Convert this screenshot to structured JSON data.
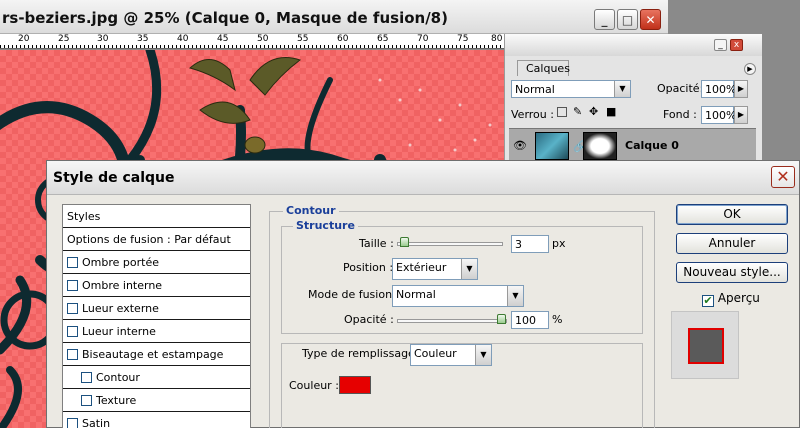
{
  "document": {
    "title": "rs-beziers.jpg @ 25% (Calque 0, Masque de fusion/8)",
    "ruler_marks": [
      "20",
      "25",
      "30",
      "35",
      "40",
      "45",
      "50",
      "55",
      "60",
      "65",
      "70",
      "75",
      "80"
    ]
  },
  "layers_panel": {
    "tab": "Calques",
    "blend_mode": "Normal",
    "opacity_label": "Opacité:",
    "opacity_value": "100%",
    "lock_label": "Verrou :",
    "fill_label": "Fond :",
    "fill_value": "100%",
    "layer_name": "Calque 0"
  },
  "dialog": {
    "title": "Style de calque",
    "styles": [
      {
        "label": "Styles",
        "type": "header"
      },
      {
        "label": "Options de fusion : Par défaut",
        "type": "header"
      },
      {
        "label": "Ombre portée",
        "type": "check"
      },
      {
        "label": "Ombre interne",
        "type": "check"
      },
      {
        "label": "Lueur externe",
        "type": "check"
      },
      {
        "label": "Lueur interne",
        "type": "check"
      },
      {
        "label": "Biseautage et estampage",
        "type": "check"
      },
      {
        "label": "Contour",
        "type": "sub"
      },
      {
        "label": "Texture",
        "type": "sub"
      },
      {
        "label": "Satin",
        "type": "check"
      }
    ],
    "contour": {
      "title": "Contour",
      "structure_title": "Structure",
      "taille_label": "Taille :",
      "taille_value": "3",
      "taille_unit": "px",
      "taille_level": 0.03,
      "position_label": "Position :",
      "position_value": "Extérieur",
      "mode_label": "Mode de fusion :",
      "mode_value": "Normal",
      "opacite_label": "Opacité :",
      "opacite_value": "100",
      "opacite_unit": "%",
      "opacite_level": 1.0,
      "remplissage_label": "Type de remplissage :",
      "remplissage_value": "Couleur",
      "couleur_label": "Couleur :",
      "couleur_color": "#e60000"
    },
    "buttons": {
      "ok": "OK",
      "cancel": "Annuler",
      "new_style": "Nouveau style...",
      "apercu": "Aperçu"
    }
  }
}
